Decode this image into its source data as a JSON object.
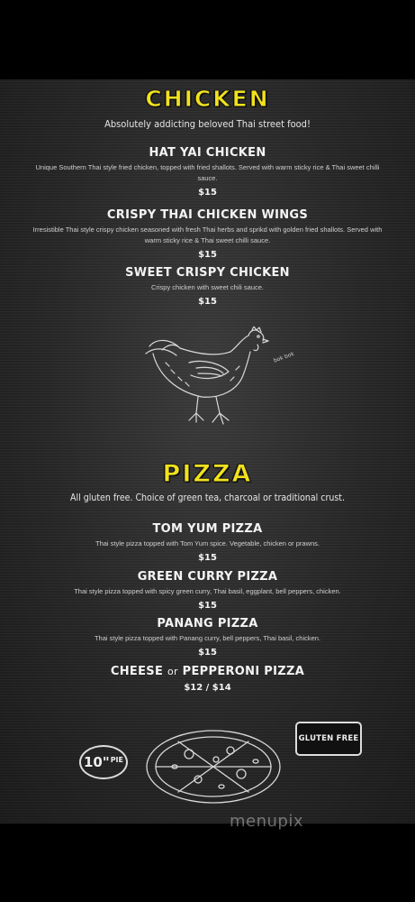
{
  "chicken": {
    "title": "CHICKEN",
    "subtitle": "Absolutely addicting beloved Thai street food!",
    "items": [
      {
        "name": "HAT YAI CHICKEN",
        "desc": "Unique Southern Thai style fried chicken, topped with fried shallots. Served with warm sticky rice & Thai sweet chilli sauce.",
        "price": "$15"
      },
      {
        "name": "CRISPY THAI CHICKEN WINGS",
        "desc": "Irresistible Thai style crispy chicken seasoned with fresh Thai herbs and sprikd with golden fried shallots. Served with warm sticky rice & Thai sweet chilli sauce.",
        "price": "$15"
      },
      {
        "name": "SWEET CRISPY CHICKEN",
        "desc": "Crispy chicken with sweet chili sauce.",
        "price": "$15"
      }
    ],
    "illustration_text": "bok bok"
  },
  "pizza": {
    "title": "PIZZA",
    "subtitle": "All gluten free. Choice of green tea, charcoal or traditional crust.",
    "items": [
      {
        "name": "TOM YUM PIZZA",
        "desc": "Thai style pizza topped with Tom Yum spice. Vegetable, chicken or prawns.",
        "price": "$15"
      },
      {
        "name": "GREEN CURRY PIZZA",
        "desc": "Thai style pizza topped with spicy green curry, Thai basil, eggplant, bell peppers, chicken.",
        "price": "$15"
      },
      {
        "name": "PANANG PIZZA",
        "desc": "Thai style pizza topped with Panang curry, bell peppers, Thai basil, chicken.",
        "price": "$15"
      },
      {
        "name_a": "CHEESE",
        "name_or": "or",
        "name_b": "PEPPERONI PIZZA",
        "price": "$12 / $14"
      }
    ],
    "size_badge": {
      "value": "10\"",
      "unit": "PIE"
    },
    "gluten_free_badge": "GLUTEN FREE"
  },
  "watermark": "menupix",
  "colors": {
    "title_yellow": "#f2e21c",
    "board": "#2a2a2a",
    "background": "#000000"
  }
}
